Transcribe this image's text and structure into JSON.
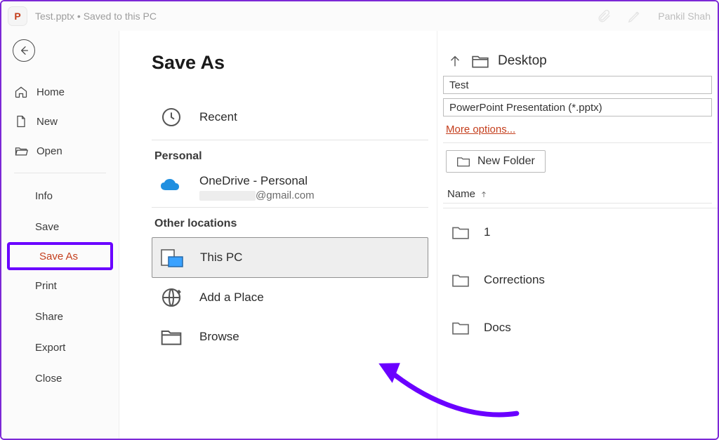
{
  "title": "Test.pptx • Saved to this PC",
  "appLetter": "P",
  "user": "Pankil Shah",
  "nav": {
    "home": "Home",
    "new": "New",
    "open": "Open",
    "info": "Info",
    "save": "Save",
    "saveAs": "Save As",
    "print": "Print",
    "share": "Share",
    "export": "Export",
    "close": "Close"
  },
  "mid": {
    "heading": "Save As",
    "recent": "Recent",
    "personal": "Personal",
    "onedriveTitle": "OneDrive - Personal",
    "onedriveEmail": "@gmail.com",
    "other": "Other locations",
    "thisPC": "This PC",
    "addPlace": "Add a Place",
    "browse": "Browse"
  },
  "right": {
    "location": "Desktop",
    "filename": "Test",
    "filetype": "PowerPoint Presentation (*.pptx)",
    "more": "More options...",
    "newFolder": "New Folder",
    "nameCol": "Name",
    "files": {
      "f0": "1",
      "f1": "Corrections",
      "f2": "Docs"
    }
  }
}
